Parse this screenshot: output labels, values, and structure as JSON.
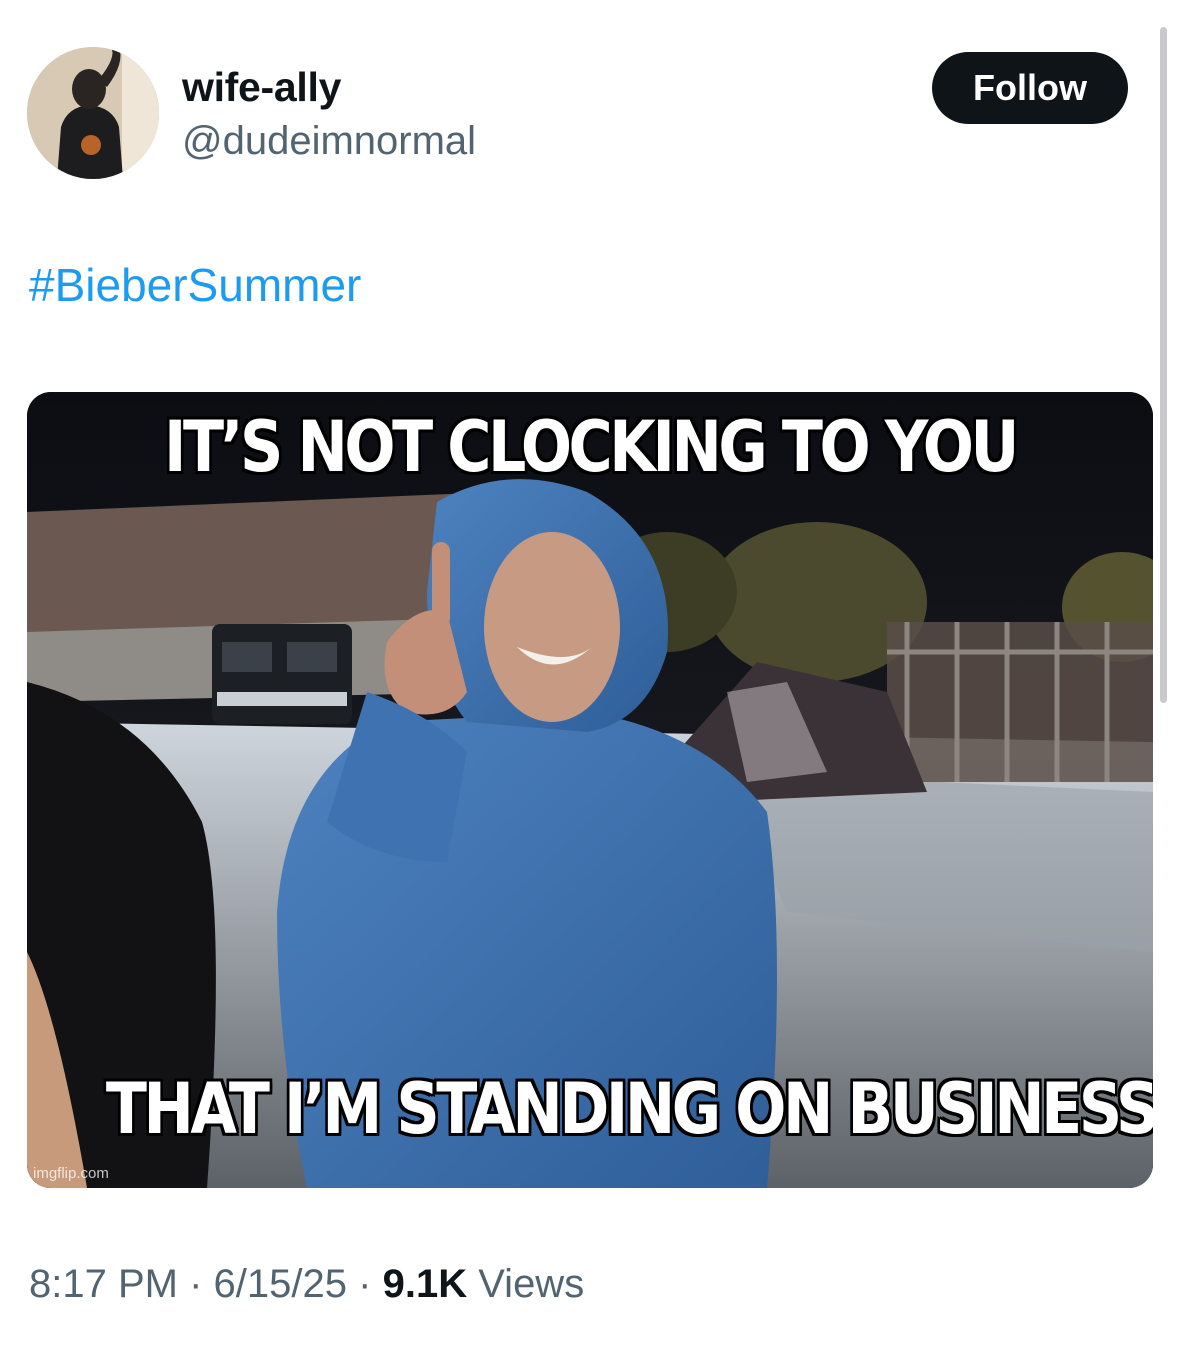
{
  "user": {
    "display_name": "wife-ally",
    "handle": "@dudeimnormal"
  },
  "follow_button": {
    "label": "Follow"
  },
  "tweet": {
    "hashtag": "#BieberSummer",
    "meme": {
      "top_caption": "IT’S NOT CLOCKING TO YOU",
      "bottom_caption": "THAT I’M STANDING ON BUSINESS",
      "watermark": "imgflip.com"
    }
  },
  "meta": {
    "time": "8:17 PM",
    "separator": "·",
    "date": "6/15/25",
    "views_count": "9.1K",
    "views_label": "Views"
  },
  "colors": {
    "link": "#1d9bf0",
    "secondary_text": "#536471",
    "button_bg": "#0f1419",
    "hoodie": "#3f73b2"
  }
}
